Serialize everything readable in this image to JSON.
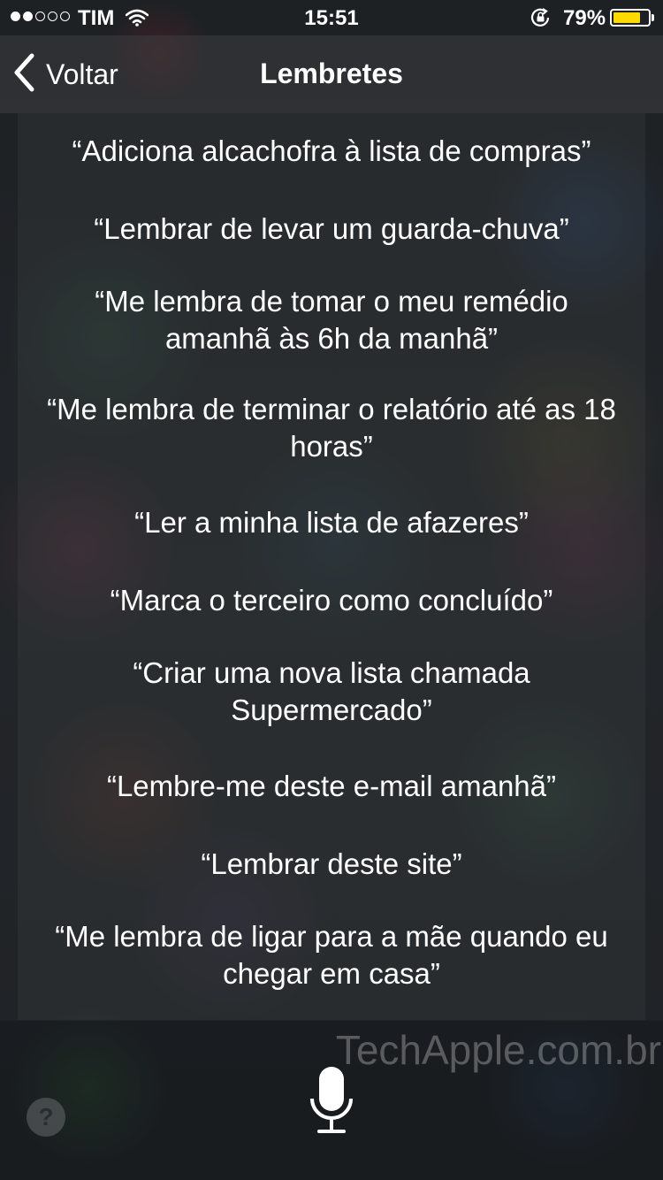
{
  "status_bar": {
    "carrier": "TIM",
    "time": "15:51",
    "battery_percent": "79%",
    "battery_level": 0.79,
    "signal_bars_filled": 2,
    "signal_bars_total": 5,
    "battery_color": "#ffd900"
  },
  "nav": {
    "back_label": "Voltar",
    "title": "Lembretes"
  },
  "phrases": [
    "“Adiciona alcachofra à lista de compras”",
    "“Lembrar de levar um guarda-chuva”",
    "“Me lembra de tomar o meu remédio amanhã às 6h da manhã”",
    "“Me lembra de terminar o relatório até as 18 horas”",
    "“Ler a minha lista de afazeres”",
    "“Marca o terceiro como concluído”",
    "“Criar uma nova lista chamada Supermercado”",
    "“Lembre-me deste e-mail amanhã”",
    "“Lembrar deste site”",
    "“Me lembra de ligar para a mãe quando eu chegar em casa”"
  ],
  "bottom": {
    "watermark": "TechApple.com.br",
    "help_label": "?"
  },
  "icons": {
    "back": "chevron-left-icon",
    "wifi": "wifi-icon",
    "rotation_lock": "rotation-lock-icon",
    "battery": "battery-icon",
    "microphone": "microphone-icon"
  }
}
